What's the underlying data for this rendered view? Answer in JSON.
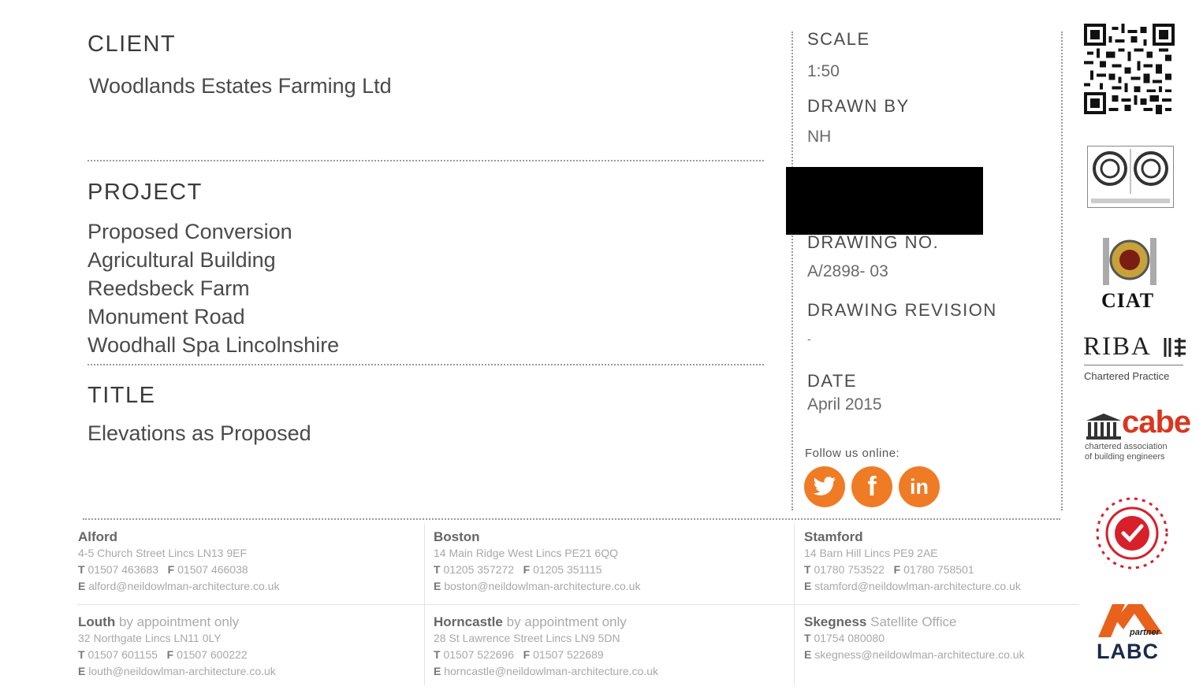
{
  "client": {
    "heading": "CLIENT",
    "name": "Woodlands Estates Farming Ltd"
  },
  "project": {
    "heading": "PROJECT",
    "lines": [
      "Proposed Conversion",
      "Agricultural Building",
      "Reedsbeck Farm",
      "Monument Road",
      "Woodhall Spa  Lincolnshire"
    ]
  },
  "title": {
    "heading": "TITLE",
    "value": "Elevations as Proposed"
  },
  "details": {
    "scale_label": "SCALE",
    "scale": "1:50",
    "drawn_by_label": "DRAWN BY",
    "drawn_by": "NH",
    "drawing_no_label": "DRAWING NO.",
    "drawing_no": "A/2898- 03",
    "revision_label": "DRAWING REVISION",
    "revision": "-",
    "date_label": "DATE",
    "date": "April 2015"
  },
  "follow": {
    "label": "Follow us online:",
    "icons": [
      "twitter-icon",
      "facebook-icon",
      "linkedin-icon"
    ]
  },
  "offices": [
    {
      "name": "Alford",
      "extra": "",
      "address": "4-5 Church Street  Lincs  LN13 9EF",
      "t": "01507 463683",
      "f": "01507 466038",
      "e": "alford@neildowlman-architecture.co.uk"
    },
    {
      "name": "Boston",
      "extra": "",
      "address": "14 Main Ridge West  Lincs  PE21 6QQ",
      "t": "01205 357272",
      "f": "01205 351115",
      "e": "boston@neildowlman-architecture.co.uk"
    },
    {
      "name": "Stamford",
      "extra": "",
      "address": "14 Barn Hill  Lincs  PE9 2AE",
      "t": "01780 753522",
      "f": "01780 758501",
      "e": "stamford@neildowlman-architecture.co.uk"
    },
    {
      "name": "Louth",
      "extra": "by appointment only",
      "address": "32 Northgate  Lincs  LN11 0LY",
      "t": "01507 601155",
      "f": "01507 600222",
      "e": "louth@neildowlman-architecture.co.uk"
    },
    {
      "name": "Horncastle",
      "extra": "by appointment only",
      "address": "28 St Lawrence Street  Lincs  LN9 5DN",
      "t": "01507 522696",
      "f": "01507 522689",
      "e": "horncastle@neildowlman-architecture.co.uk"
    },
    {
      "name": "Skegness",
      "extra": "Satellite Office",
      "address": "",
      "t": "01754 080080",
      "f": "",
      "e": "skegness@neildowlman-architecture.co.uk"
    }
  ],
  "logos": {
    "ciat": "CIAT",
    "riba": "RIBA",
    "riba_sub": "Chartered Practice",
    "cabe": "cabe",
    "cabe_sub1": "chartered association",
    "cabe_sub2": "of building engineers",
    "labc_partner": "partner",
    "labc": "LABC"
  },
  "colors": {
    "accent": "#f07b25",
    "cabe_red": "#d9361f",
    "labc_orange": "#e8621c",
    "redaction": "#000000"
  }
}
